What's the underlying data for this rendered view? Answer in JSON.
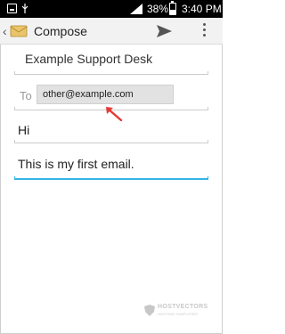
{
  "status_bar": {
    "battery_text": "38%",
    "battery_level": 0.38,
    "time": "3:40 PM"
  },
  "action_bar": {
    "title": "Compose",
    "icons": [
      "up-icon",
      "email-app-icon",
      "send-icon",
      "overflow-menu-icon"
    ]
  },
  "compose": {
    "from": "Example Support Desk",
    "to_label": "To",
    "to_recipient": "other@example.com",
    "subject": "Hi",
    "body": "This is my first email."
  },
  "watermark": {
    "title": "HOSTVECTORS",
    "subtitle": "HOSTING SIMPLIFIED"
  },
  "colors": {
    "accent": "#33b5e5",
    "annotation_arrow": "#e53935",
    "action_bar_bg": "#f2f2f2",
    "status_bar_bg": "#000000"
  }
}
